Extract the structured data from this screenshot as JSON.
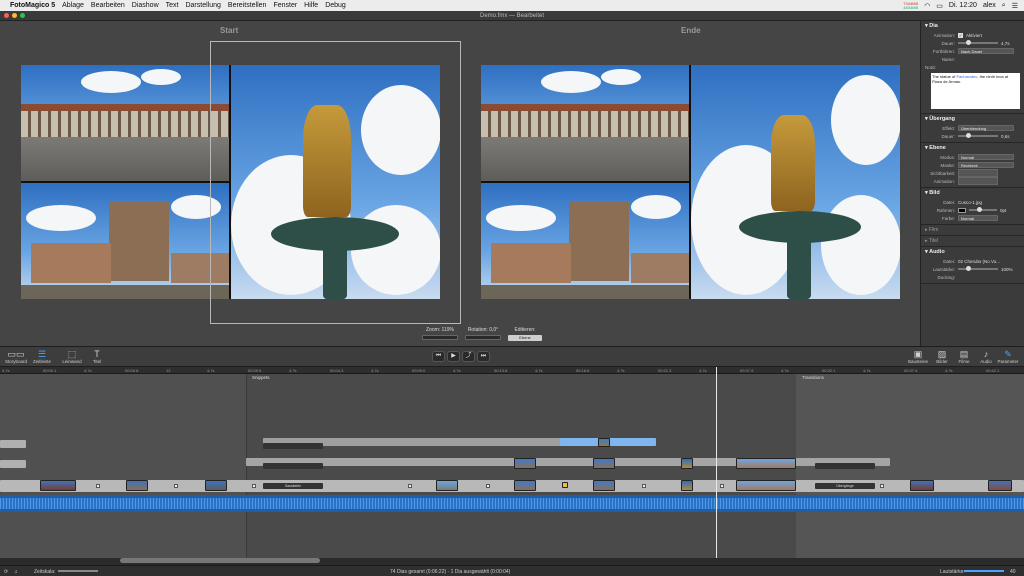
{
  "menubar": {
    "apple": "",
    "app_name": "FotoMagico 5",
    "items": [
      "Ablage",
      "Bearbeiten",
      "Diashow",
      "Text",
      "Darstellung",
      "Bereitstellen",
      "Fenster",
      "Hilfe",
      "Debug"
    ],
    "status_top": "7344MB",
    "status_bottom": "4834MB",
    "clock": "Di. 12:20",
    "user": "alex"
  },
  "window": {
    "title": "Demo.fmx — Bearbeitet"
  },
  "stage": {
    "start_label": "Start",
    "end_label": "Ende",
    "zoom_label": "Zoom: 119%",
    "rotation_label": "Rotation: 0,0°",
    "edit_label": "Editieren:",
    "edit_button": "Ebene"
  },
  "inspector": {
    "dia": {
      "title": "Dia",
      "animation_label": "Animation:",
      "animation_value": "Aktiviert",
      "duration_label": "Dauer:",
      "duration_value": "4,7s",
      "advance_label": "Fortfahren:",
      "advance_value": "Nach Dauer",
      "name_label": "Name:",
      "note_label": "Notiz:",
      "note_pre": "The statue of ",
      "note_link": "Pachacutec",
      "note_post": ", the ninth Inca at Plaza de Armas."
    },
    "transition": {
      "title": "Übergang",
      "effect_label": "Effekt:",
      "effect_value": "Überblendung",
      "duration_label": "Dauer:",
      "duration_value": "0,6s"
    },
    "layer": {
      "title": "Ebene",
      "mode_label": "Modus:",
      "mode_value": "Normal",
      "mask_label": "Maske:",
      "mask_value": "Rechteck",
      "visibility_label": "Sichtbarkeit:",
      "animation_label": "Animation:"
    },
    "image": {
      "title": "Bild",
      "file_label": "Datei:",
      "file_value": "Cusco-1.jpg",
      "frame_label": "Rahmen:",
      "frame_value": "0pt",
      "color_label": "Farbe:",
      "color_value": "Normal"
    },
    "film": "Film",
    "title_section": "Titel",
    "audio": {
      "title": "Audio",
      "file_label": "Datei:",
      "file_value": "02 Cherubs (No Vo...",
      "volume_label": "Lautstärke:",
      "volume_value": "100%",
      "ducking_label": "Ducking:"
    }
  },
  "toolbar": {
    "left": [
      {
        "label": "Storyboard",
        "icon": "storyboard-icon"
      },
      {
        "label": "Zeitleiste",
        "icon": "timeline-icon"
      },
      {
        "label": "Leinwand",
        "icon": "canvas-icon"
      },
      {
        "label": "Titel",
        "icon": "title-icon"
      }
    ],
    "playback": [
      "⏮",
      "▶",
      "⤴",
      "⏭"
    ],
    "right": [
      {
        "label": "Bausteine",
        "icon": "building-blocks-icon"
      },
      {
        "label": "Bilder",
        "icon": "images-icon"
      },
      {
        "label": "Filme",
        "icon": "movies-icon"
      },
      {
        "label": "Audio",
        "icon": "audio-icon"
      },
      {
        "label": "Parameter",
        "icon": "parameters-icon"
      }
    ]
  },
  "timeline": {
    "ruler": [
      "4,7s",
      "00:00.1",
      "4,7s",
      "00:04.8",
      "12",
      "4,7s",
      "00:09.6",
      "4,7s",
      "00:04.3",
      "4,7s",
      "00:09.0",
      "4,7s",
      "00:13.8",
      "4,7s",
      "00:18.6",
      "4,7s",
      "00:21.3",
      "4,7s",
      "00:37.9",
      "4,7s",
      "00:32.1",
      "4,7s",
      "00:37.4",
      "4,7s",
      "00:42.1"
    ],
    "sections": [
      "Snippets",
      "Transitions"
    ],
    "clip_labels": [
      "Sauskelen",
      "Übergänge"
    ]
  },
  "statusbar": {
    "zoom_label": "Zeitskala:",
    "summary": "74 Dias gesamt (0:06:22) · 1 Dia ausgewählt (0:00:04)",
    "volume_label": "Lautstärke:",
    "volume_value": "40"
  },
  "colors": {
    "accent": "#4da3ff",
    "audio_track": "#1f5fa8",
    "selected_clip": "#7fb6f0"
  }
}
